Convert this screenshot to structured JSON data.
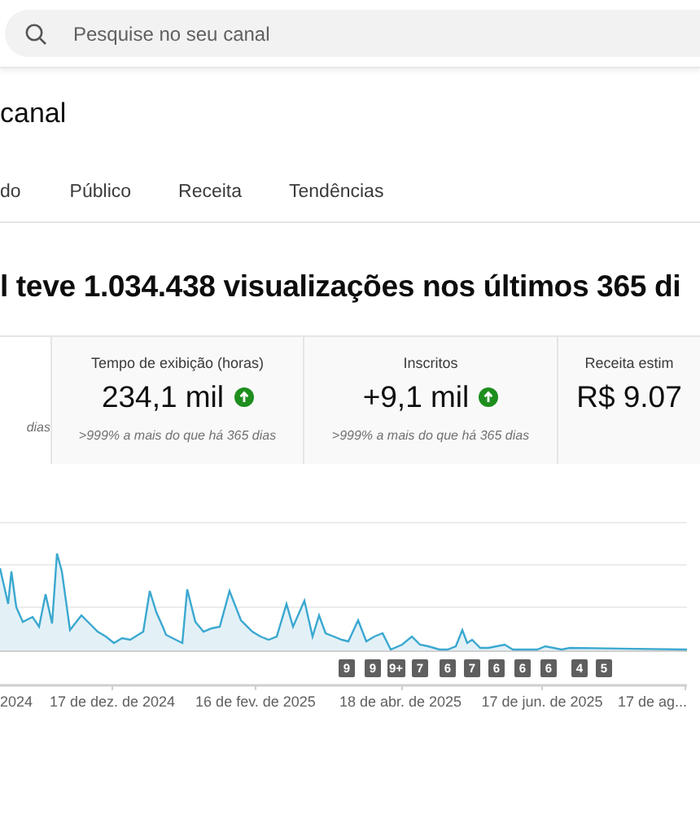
{
  "search": {
    "placeholder": "Pesquise no seu canal"
  },
  "page_title": "canal",
  "tabs": [
    {
      "label": "do",
      "selected": false
    },
    {
      "label": "Público",
      "selected": false
    },
    {
      "label": "Receita",
      "selected": false
    },
    {
      "label": "Tendências",
      "selected": false
    }
  ],
  "headline": "l teve 1.034.438 visualizações nos últimos 365 di",
  "cards": [
    {
      "comparison": "dias"
    },
    {
      "title": "Tempo de exibição (horas)",
      "value": "234,1 mil",
      "up": true,
      "comparison": ">999% a mais do que há 365 dias"
    },
    {
      "title": "Inscritos",
      "value": "+9,1 mil",
      "up": true,
      "comparison": ">999% a mais do que há 365 dias"
    },
    {
      "title": "Receita estim",
      "value": "R$ 9.07"
    }
  ],
  "chart": {
    "badges": [
      "9",
      "9",
      "9+",
      "7",
      "6",
      "7",
      "6",
      "6",
      "6",
      "4",
      "5"
    ],
    "x_labels": [
      "2024",
      "17 de dez. de 2024",
      "16 de fev. de 2025",
      "18 de abr. de 2025",
      "17 de jun. de 2025",
      "17 de ag..."
    ]
  }
}
